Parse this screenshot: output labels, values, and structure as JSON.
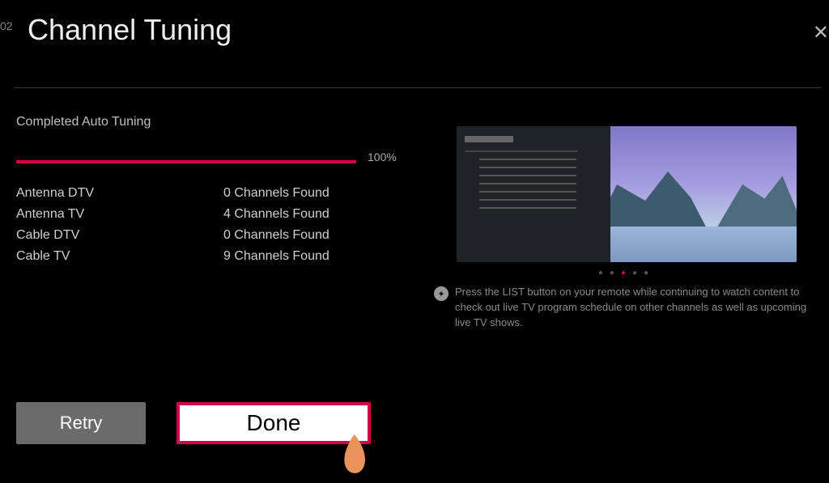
{
  "time_label": "02",
  "title": "Channel Tuning",
  "status": "Completed Auto Tuning",
  "progress_percent": "100%",
  "results": [
    {
      "label": "Antenna DTV",
      "value": "0 Channels Found"
    },
    {
      "label": "Antenna TV",
      "value": "4 Channels Found"
    },
    {
      "label": "Cable DTV",
      "value": "0 Channels Found"
    },
    {
      "label": "Cable TV",
      "value": "9 Channels Found"
    }
  ],
  "help_text": "Press the LIST button on your remote while continuing to watch content to check out live TV program schedule on other channels as well as upcoming live TV shows.",
  "buttons": {
    "retry": "Retry",
    "done": "Done"
  },
  "carousel": {
    "count": 5,
    "active_index": 2
  }
}
